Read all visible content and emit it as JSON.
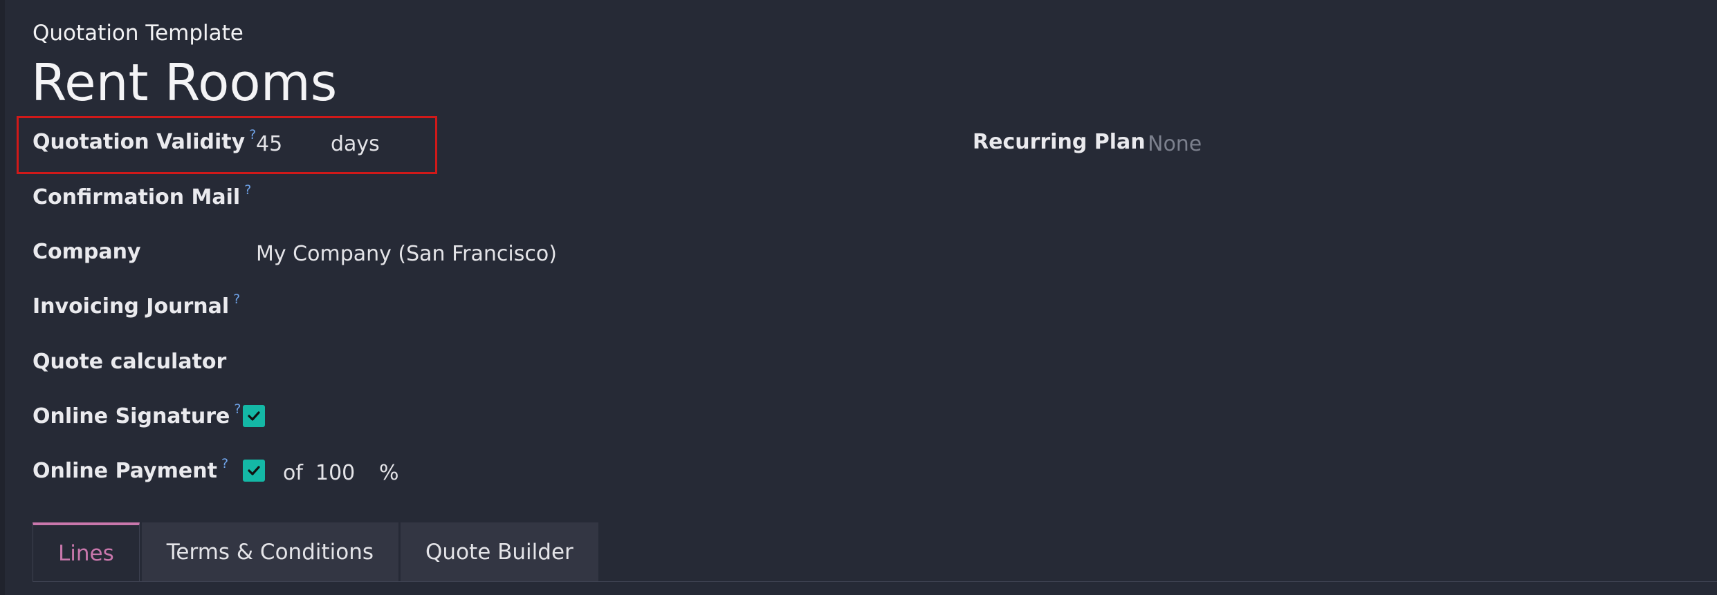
{
  "header": {
    "breadcrumb": "Quotation Template",
    "title": "Rent Rooms"
  },
  "fields": {
    "quotation_validity": {
      "label": "Quotation Validity",
      "help": "?",
      "value": "45",
      "unit": "days"
    },
    "confirmation_mail": {
      "label": "Confirmation Mail",
      "help": "?",
      "value": ""
    },
    "company": {
      "label": "Company",
      "value": "My Company (San Francisco)"
    },
    "invoicing_journal": {
      "label": "Invoicing Journal",
      "help": "?",
      "value": ""
    },
    "quote_calculator": {
      "label": "Quote calculator",
      "value": ""
    },
    "online_signature": {
      "label": "Online Signature",
      "help": "?",
      "checked": true
    },
    "online_payment": {
      "label": "Online Payment",
      "help": "?",
      "checked": true,
      "prefix": "of",
      "value": "100",
      "unit": "%"
    },
    "recurring_plan": {
      "label": "Recurring Plan",
      "placeholder": "None"
    }
  },
  "tabs": [
    {
      "label": "Lines",
      "active": true
    },
    {
      "label": "Terms & Conditions",
      "active": false
    },
    {
      "label": "Quote Builder",
      "active": false
    }
  ],
  "colors": {
    "background": "#262a36",
    "accent": "#c977ac",
    "checkbox": "#14b8a6",
    "help": "#6fa3e8",
    "highlight": "#d01919"
  }
}
